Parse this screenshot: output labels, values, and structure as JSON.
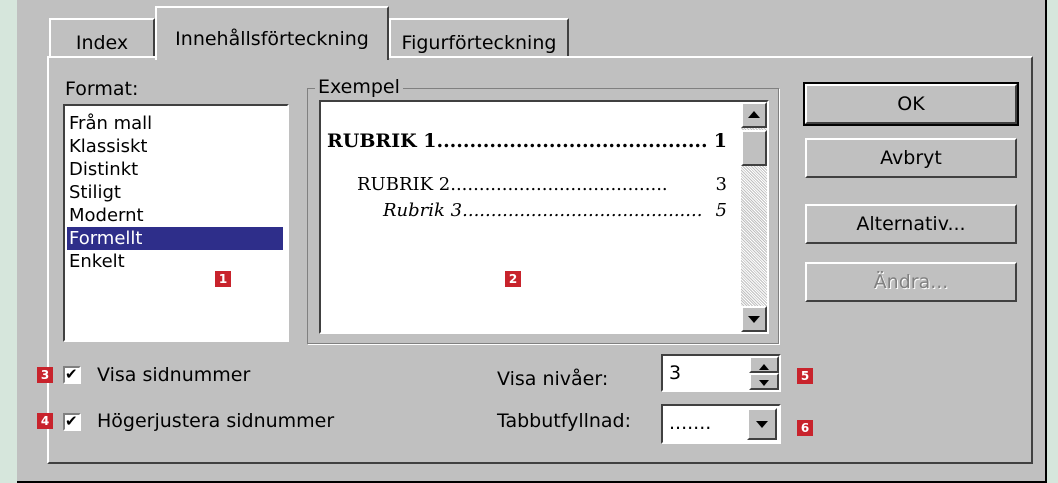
{
  "tabs": [
    {
      "label": "Index"
    },
    {
      "label": "Innehållsförteckning"
    },
    {
      "label": "Figurförteckning"
    }
  ],
  "format": {
    "label": "Format:",
    "items": [
      "Från mall",
      "Klassiskt",
      "Distinkt",
      "Stiligt",
      "Modernt",
      "Formellt",
      "Enkelt"
    ],
    "selected": "Formellt"
  },
  "preview": {
    "label": "Exempel",
    "rubrik1": "RUBRIK 1",
    "rubrik1_dots": ".........................................",
    "rubrik1_page": "1",
    "rubrik2": "RUBRIK 2",
    "rubrik2_dots": "......................................",
    "rubrik2_page": "3",
    "rubrik3": "Rubrik 3",
    "rubrik3_dots": "..........................................",
    "rubrik3_page": "5"
  },
  "buttons": {
    "ok": "OK",
    "cancel": "Avbryt",
    "options": "Alternativ...",
    "modify": "Ändra..."
  },
  "options": {
    "show_page_numbers": "Visa sidnummer",
    "right_align": "Högerjustera sidnummer",
    "show_levels_label": "Visa nivåer:",
    "show_levels_value": "3",
    "tab_leader_label": "Tabbutfyllnad:",
    "tab_leader_value": "......."
  },
  "badges": [
    "1",
    "2",
    "3",
    "4",
    "5",
    "6"
  ],
  "colors": {
    "background": "#d6e6dc",
    "dialog": "#c0c0c0",
    "selection": "#2e2e8a",
    "badge": "#c8232c"
  }
}
